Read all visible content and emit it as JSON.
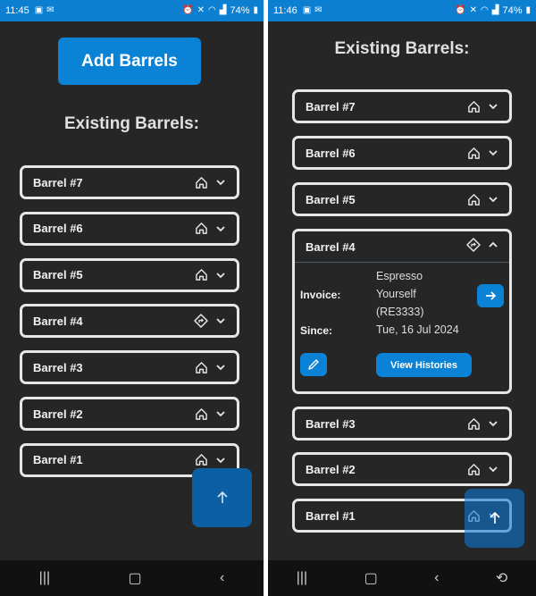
{
  "left": {
    "status": {
      "time": "11:45",
      "battery": "74%"
    },
    "add_button": "Add Barrels",
    "heading": "Existing Barrels:",
    "barrels": [
      {
        "label": "Barrel #7",
        "icon": "home-icon"
      },
      {
        "label": "Barrel #6",
        "icon": "home-icon"
      },
      {
        "label": "Barrel #5",
        "icon": "home-icon"
      },
      {
        "label": "Barrel #4",
        "icon": "directions-icon"
      },
      {
        "label": "Barrel #3",
        "icon": "home-icon"
      },
      {
        "label": "Barrel #2",
        "icon": "home-icon"
      },
      {
        "label": "Barrel #1",
        "icon": "home-icon"
      }
    ]
  },
  "right": {
    "status": {
      "time": "11:46",
      "battery": "74%"
    },
    "heading": "Existing Barrels:",
    "barrels": [
      {
        "label": "Barrel #7",
        "icon": "home-icon"
      },
      {
        "label": "Barrel #6",
        "icon": "home-icon"
      },
      {
        "label": "Barrel #5",
        "icon": "home-icon"
      },
      {
        "label": "Barrel #4",
        "icon": "directions-icon",
        "expanded": true
      },
      {
        "label": "Barrel #3",
        "icon": "home-icon"
      },
      {
        "label": "Barrel #2",
        "icon": "home-icon"
      },
      {
        "label": "Barrel #1",
        "icon": "home-icon"
      }
    ],
    "detail": {
      "invoice_label": "Invoice:",
      "since_label": "Since:",
      "line1": "Espresso",
      "line2": "Yourself",
      "line3": "(RE3333)",
      "line4": "Tue, 16 Jul 2024",
      "view_histories": "View Histories"
    }
  },
  "colors": {
    "accent": "#0a82d6",
    "status_bar": "#0d7fd1",
    "background": "#262626"
  }
}
